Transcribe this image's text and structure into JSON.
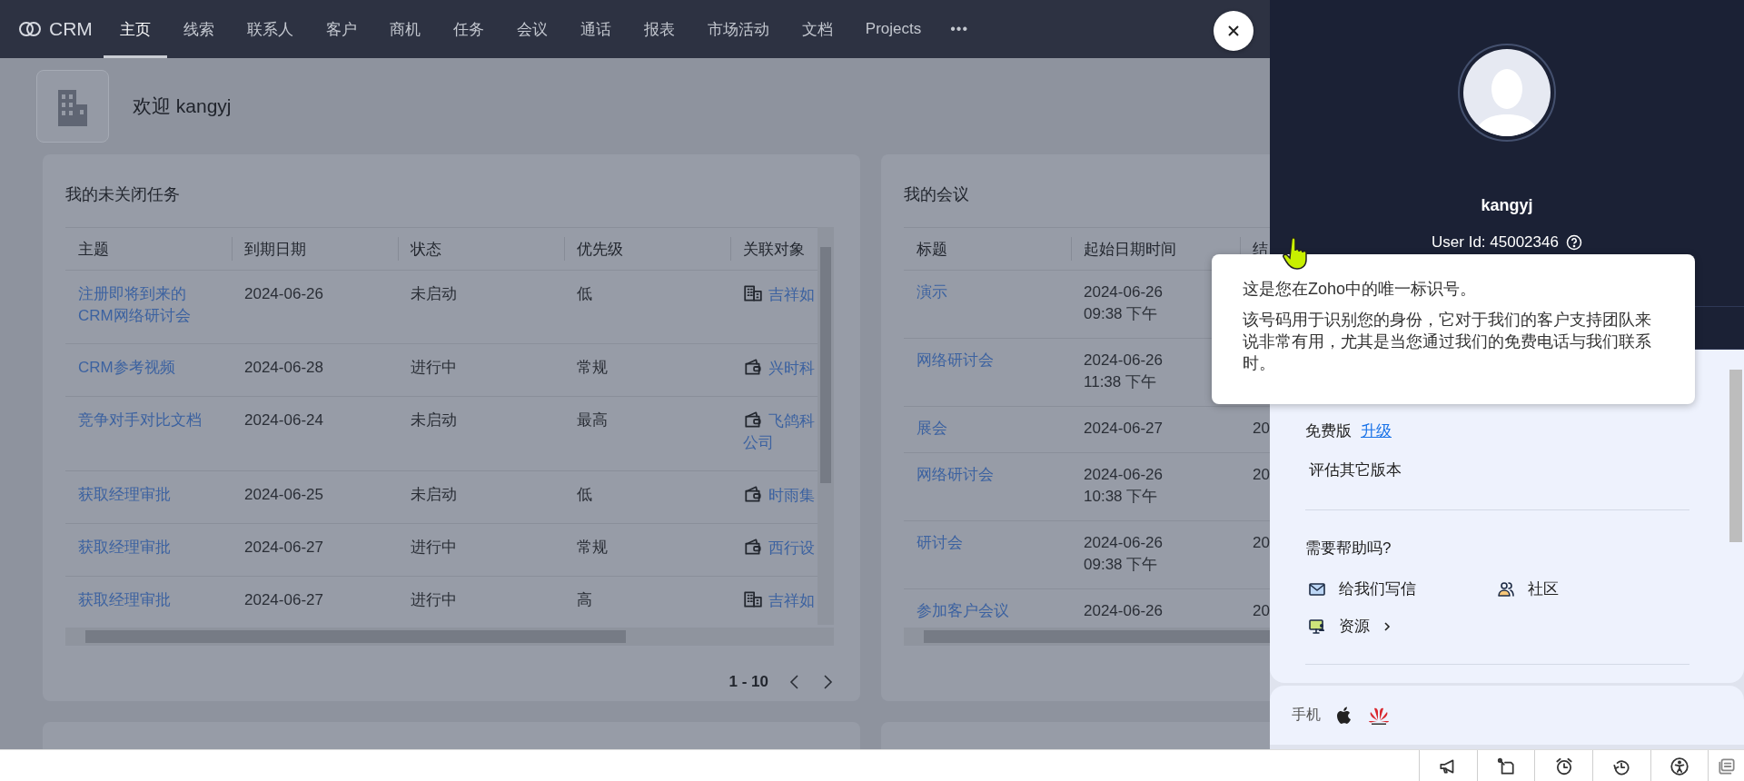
{
  "nav": {
    "logo": "CRM",
    "more": "•••",
    "tabs": [
      {
        "label": "主页",
        "selected": true
      },
      {
        "label": "线索",
        "selected": false
      },
      {
        "label": "联系人",
        "selected": false
      },
      {
        "label": "客户",
        "selected": false
      },
      {
        "label": "商机",
        "selected": false
      },
      {
        "label": "任务",
        "selected": false
      },
      {
        "label": "会议",
        "selected": false
      },
      {
        "label": "通话",
        "selected": false
      },
      {
        "label": "报表",
        "selected": false
      },
      {
        "label": "市场活动",
        "selected": false
      },
      {
        "label": "文档",
        "selected": false
      },
      {
        "label": "Projects",
        "selected": false
      }
    ]
  },
  "welcome": "欢迎 kangyj",
  "tasks": {
    "title": "我的未关闭任务",
    "columns": [
      "主题",
      "到期日期",
      "状态",
      "优先级",
      "关联对象"
    ],
    "rows": [
      {
        "subject": "注册即将到来的CRM网络研讨会",
        "due": "2024-06-26",
        "status": "未启动",
        "priority": "低",
        "related": {
          "kind": "building",
          "name": "吉祥如"
        }
      },
      {
        "subject": "CRM参考视频",
        "due": "2024-06-28",
        "status": "进行中",
        "priority": "常规",
        "related": {
          "kind": "wallet",
          "name": "兴时科"
        }
      },
      {
        "subject": "竞争对手对比文档",
        "due": "2024-06-24",
        "status": "未启动",
        "priority": "最高",
        "related": {
          "kind": "wallet",
          "name": "飞鸽科公司"
        }
      },
      {
        "subject": "获取经理审批",
        "due": "2024-06-25",
        "status": "未启动",
        "priority": "低",
        "related": {
          "kind": "wallet",
          "name": "时雨集"
        }
      },
      {
        "subject": "获取经理审批",
        "due": "2024-06-27",
        "status": "进行中",
        "priority": "常规",
        "related": {
          "kind": "wallet",
          "name": "西行设"
        }
      },
      {
        "subject": "获取经理审批",
        "due": "2024-06-27",
        "status": "进行中",
        "priority": "高",
        "related": {
          "kind": "building",
          "name": "吉祥如"
        }
      }
    ],
    "pagination": "1 - 10"
  },
  "meetings": {
    "title": "我的会议",
    "columns": [
      "标题",
      "起始日期时间",
      "结"
    ],
    "rows": [
      {
        "title": "演示",
        "start": "2024-06-26 09:38 下午"
      },
      {
        "title": "网络研讨会",
        "start": "2024-06-26 11:38 下午"
      },
      {
        "title": "展会",
        "start": "2024-06-27",
        "column_3": "20"
      },
      {
        "title": "网络研讨会",
        "start": "2024-06-26 10:38 下午",
        "column_3": "20"
      },
      {
        "title": "研讨会",
        "start": "2024-06-26 09:38 下午",
        "column_3": "20"
      },
      {
        "title": "参加客户会议",
        "start": "2024-06-26",
        "column_3": "20"
      }
    ]
  },
  "profile": {
    "name": "kangyj",
    "user_id": "User Id: 45002346"
  },
  "tooltip": {
    "heading": "这是您在Zoho中的唯一标识号。",
    "body": "该号码用于识别您的身份，它对于我们的客户支持团队来说非常有用，尤其是当您通过我们的免费电话与我们联系时。"
  },
  "plan": {
    "name": "免费版",
    "upgrade": "升级",
    "evaluate": "评估其它版本"
  },
  "help": {
    "title": "需要帮助吗?",
    "items": [
      {
        "kind": "mail",
        "label": "给我们写信"
      },
      {
        "kind": "people",
        "label": "社区"
      },
      {
        "kind": "resources",
        "label": "资源"
      }
    ]
  },
  "mobile": {
    "label": "手机",
    "apps": [
      {
        "kind": "apple"
      },
      {
        "kind": "huawei"
      }
    ]
  },
  "bottom_bar": [
    {
      "kind": "megaphone"
    },
    {
      "kind": "note"
    },
    {
      "kind": "alarm"
    },
    {
      "kind": "history"
    },
    {
      "kind": "accessibility"
    },
    {
      "kind": "chat"
    }
  ]
}
